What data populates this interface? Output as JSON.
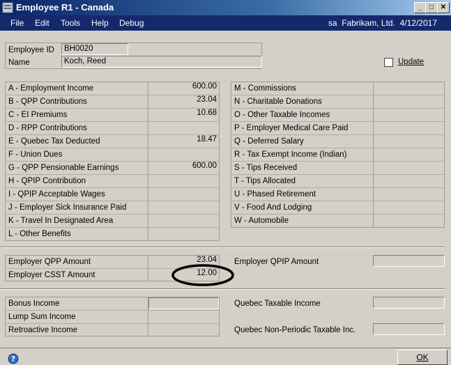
{
  "window": {
    "title": "Employee R1 - Canada"
  },
  "menu": {
    "items": [
      "File",
      "Edit",
      "Tools",
      "Help",
      "Debug"
    ]
  },
  "status": {
    "user": "sa",
    "company": "Fabrikam, Ltd.",
    "date": "4/12/2017"
  },
  "header": {
    "employee_id_label": "Employee ID",
    "employee_id": "BH0020",
    "name_label": "Name",
    "name": "Koch, Reed",
    "update_label": "Update"
  },
  "left_boxes": [
    {
      "label": "A - Employment Income",
      "value": "600.00"
    },
    {
      "label": "B - QPP Contributions",
      "value": "23.04"
    },
    {
      "label": "C - EI Premiums",
      "value": "10.68"
    },
    {
      "label": "D - RPP Contributions",
      "value": ""
    },
    {
      "label": "E - Quebec Tax Deducted",
      "value": "18.47"
    },
    {
      "label": "F - Union Dues",
      "value": ""
    },
    {
      "label": "G - QPP Pensionable Earnings",
      "value": "600.00"
    },
    {
      "label": "H - QPIP Contribution",
      "value": ""
    },
    {
      "label": "I - QPIP Acceptable Wages",
      "value": ""
    },
    {
      "label": "J - Employer Sick Insurance Paid",
      "value": ""
    },
    {
      "label": "K - Travel In Designated Area",
      "value": ""
    },
    {
      "label": "L - Other Benefits",
      "value": ""
    }
  ],
  "right_boxes": [
    {
      "label": "M - Commissions",
      "value": ""
    },
    {
      "label": "N - Charitable Donations",
      "value": ""
    },
    {
      "label": "O - Other Taxable Incomes",
      "value": ""
    },
    {
      "label": "P - Employer Medical Care Paid",
      "value": ""
    },
    {
      "label": "Q - Deferred Salary",
      "value": ""
    },
    {
      "label": "R - Tax Exempt Income (Indian)",
      "value": ""
    },
    {
      "label": "S - Tips Received",
      "value": ""
    },
    {
      "label": "T - Tips Allocated",
      "value": ""
    },
    {
      "label": "U - Phased Retirement",
      "value": ""
    },
    {
      "label": "V - Food And Lodging",
      "value": ""
    },
    {
      "label": "W - Automobile",
      "value": ""
    }
  ],
  "employer": {
    "qpp_label": "Employer QPP Amount",
    "qpp": "23.04",
    "csst_label": "Employer CSST Amount",
    "csst": "12.00",
    "qpip_label": "Employer QPIP Amount",
    "qpip": ""
  },
  "other": {
    "bonus_label": "Bonus Income",
    "bonus": "",
    "lump_label": "Lump Sum Income",
    "lump": "",
    "retro_label": "Retroactive Income",
    "retro": "",
    "qti_label": "Quebec Taxable Income",
    "qti": "",
    "qnp_label": "Quebec Non-Periodic Taxable Inc.",
    "qnp": ""
  },
  "buttons": {
    "ok": "OK"
  },
  "annotation_color": "#000000"
}
